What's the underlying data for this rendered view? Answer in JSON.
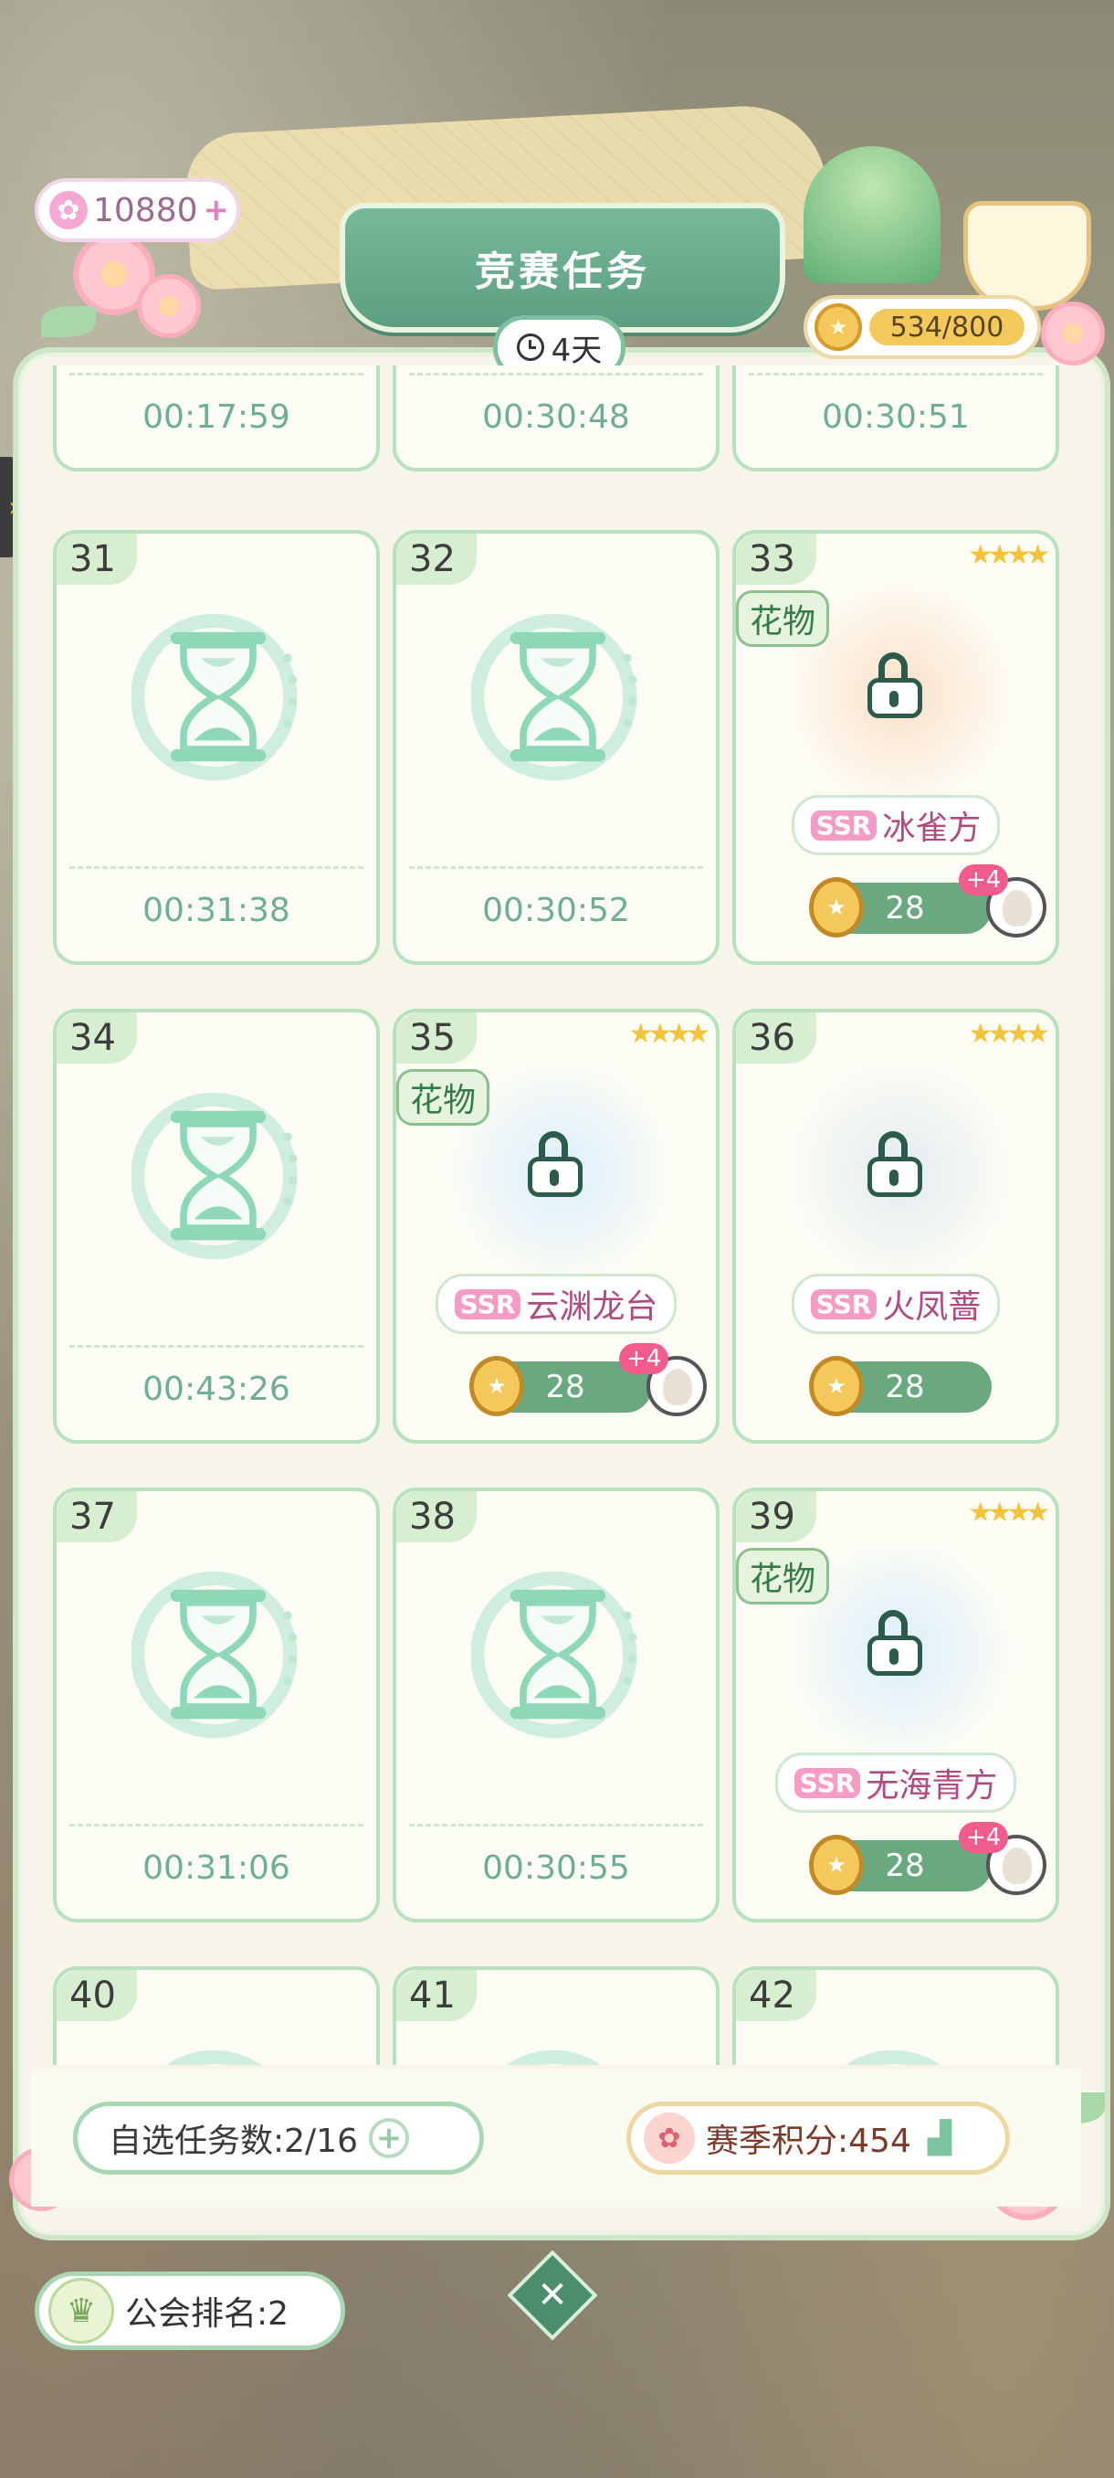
{
  "header": {
    "title": "竞赛任务",
    "remaining_time": "4天",
    "gems": "10880",
    "medals": "534/800"
  },
  "top_partial_times": [
    "00:17:59",
    "00:30:48",
    "00:30:51"
  ],
  "tasks": [
    {
      "num": "31",
      "time": "00:31:38"
    },
    {
      "num": "32",
      "time": "00:30:52"
    },
    {
      "num": "33",
      "tag": "花物",
      "rarity": "SSR",
      "name": "冰雀方",
      "reward": "28",
      "bonus": "+4"
    },
    {
      "num": "34",
      "time": "00:43:26"
    },
    {
      "num": "35",
      "tag": "花物",
      "rarity": "SSR",
      "name": "云渊龙台",
      "reward": "28",
      "bonus": "+4"
    },
    {
      "num": "36",
      "rarity": "SSR",
      "name": "火凤蔷",
      "reward": "28"
    },
    {
      "num": "37",
      "time": "00:31:06"
    },
    {
      "num": "38",
      "time": "00:30:55"
    },
    {
      "num": "39",
      "tag": "花物",
      "rarity": "SSR",
      "name": "无海青方",
      "reward": "28",
      "bonus": "+4"
    },
    {
      "num": "40"
    },
    {
      "num": "41"
    },
    {
      "num": "42"
    }
  ],
  "footer": {
    "self_select": "自选任务数:2/16",
    "season_score": "赛季积分:454",
    "guild_rank": "公会排名:2"
  },
  "colors": {
    "accent": "#6aa980",
    "panel": "#f7f5ea",
    "card_border": "#b8e1c0"
  }
}
